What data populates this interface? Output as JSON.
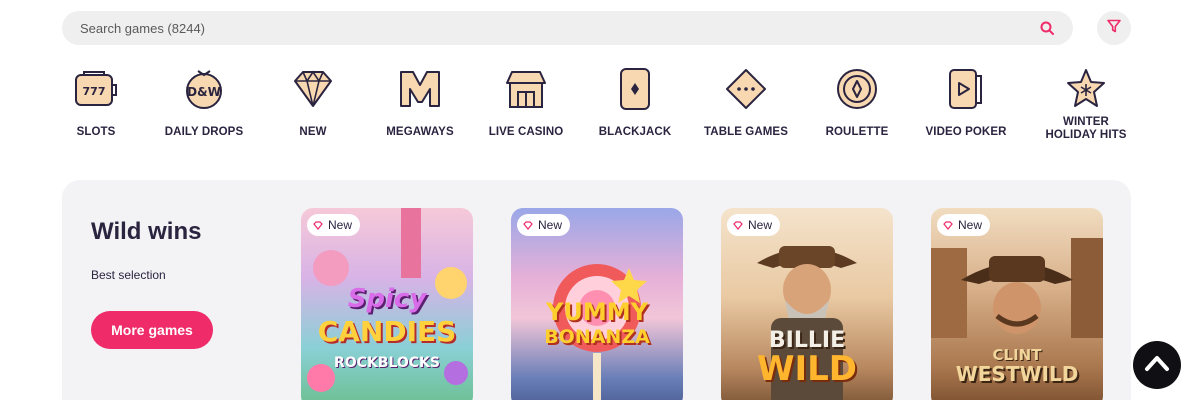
{
  "search": {
    "placeholder": "Search games (8244)"
  },
  "icons": {
    "search": "search-icon",
    "filter": "filter-icon",
    "scroll_top": "chevron-up-icon",
    "badge": "diamond-icon"
  },
  "colors": {
    "accent": "#ef2b6a",
    "icon": "#e9b87a",
    "text": "#2b2440"
  },
  "categories": [
    {
      "label": "SLOTS",
      "icon": "slots-icon"
    },
    {
      "label": "DAILY DROPS",
      "icon": "daily-drops-icon"
    },
    {
      "label": "NEW",
      "icon": "diamond-icon"
    },
    {
      "label": "MEGAWAYS",
      "icon": "megaways-icon"
    },
    {
      "label": "LIVE CASINO",
      "icon": "live-casino-icon"
    },
    {
      "label": "BLACKJACK",
      "icon": "card-icon"
    },
    {
      "label": "TABLE GAMES",
      "icon": "dice-icon"
    },
    {
      "label": "ROULETTE",
      "icon": "roulette-icon"
    },
    {
      "label": "VIDEO POKER",
      "icon": "video-poker-icon"
    },
    {
      "label_line1": "WINTER",
      "label_line2": "HOLIDAY HITS",
      "icon": "snowflake-star-icon"
    }
  ],
  "promo": {
    "title": "Wild wins",
    "subtitle": "Best selection",
    "button": "More games",
    "games": [
      {
        "badge": "New",
        "title_line1": "Spicy",
        "title_line2": "CANDIES",
        "title_line3": "ROCKBLOCKS"
      },
      {
        "badge": "New",
        "title_line1": "YUMMY",
        "title_line2": "BONANZA"
      },
      {
        "badge": "New",
        "title_line1": "BILLIE",
        "title_line2": "WILD"
      },
      {
        "badge": "New",
        "title_line1": "CLINT",
        "title_line2": "WESTWILD"
      }
    ]
  }
}
